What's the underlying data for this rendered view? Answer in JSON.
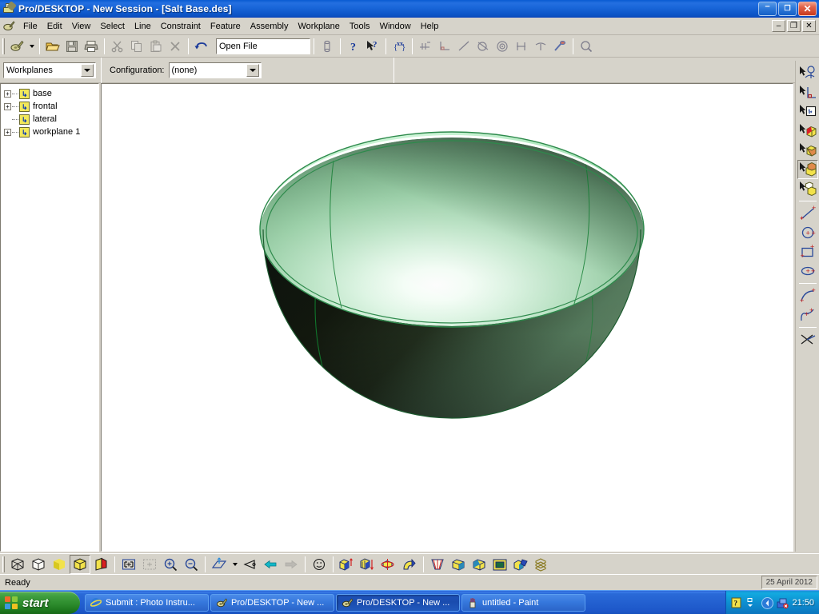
{
  "window": {
    "title": "Pro/DESKTOP - New Session - [Salt Base.des]",
    "app_icon": "printer-pen-icon",
    "minimize_label": "–",
    "restore_label": "❐",
    "close_label": "✕",
    "mdi_minimize_label": "–",
    "mdi_restore_label": "❐",
    "mdi_close_label": "✕"
  },
  "menubar": {
    "items": [
      {
        "label": "File"
      },
      {
        "label": "Edit"
      },
      {
        "label": "View"
      },
      {
        "label": "Select"
      },
      {
        "label": "Line"
      },
      {
        "label": "Constraint"
      },
      {
        "label": "Feature"
      },
      {
        "label": "Assembly"
      },
      {
        "label": "Workplane"
      },
      {
        "label": "Tools"
      },
      {
        "label": "Window"
      },
      {
        "label": "Help"
      }
    ]
  },
  "toolbar_main": {
    "buttons": [
      {
        "name": "new-design-button",
        "icon": "printer-pen-icon"
      },
      {
        "name": "new-design-dropdown",
        "icon": "chevron-down-icon"
      },
      {
        "name": "open-button",
        "icon": "open-folder-icon"
      },
      {
        "name": "save-button",
        "icon": "floppy-disk-icon"
      },
      {
        "name": "print-button",
        "icon": "printer-icon"
      },
      {
        "name": "cut-button",
        "icon": "scissors-icon"
      },
      {
        "name": "copy-button",
        "icon": "copy-icon"
      },
      {
        "name": "paste-button",
        "icon": "clipboard-icon"
      },
      {
        "name": "delete-button",
        "icon": "x-delete-icon"
      },
      {
        "name": "undo-button",
        "icon": "undo-arrow-icon"
      }
    ],
    "command_combo": {
      "value": "Open File",
      "placeholder": "Open File"
    },
    "buttons_right": [
      {
        "name": "properties-button",
        "icon": "cylinder-icon"
      },
      {
        "name": "help-button",
        "icon": "question-mark-icon"
      },
      {
        "name": "context-help-button",
        "icon": "arrow-question-icon"
      },
      {
        "name": "dimension-button",
        "icon": "xx-dimension-icon"
      },
      {
        "name": "add-dimension-button",
        "icon": "hash-dimension-icon"
      },
      {
        "name": "angle-constraint-button",
        "icon": "right-angle-icon"
      },
      {
        "name": "line-constraint-button",
        "icon": "diagonal-line-icon"
      },
      {
        "name": "tangent-constraint-button",
        "icon": "tangent-circle-icon"
      },
      {
        "name": "concentric-constraint-button",
        "icon": "concentric-circles-icon"
      },
      {
        "name": "equal-constraint-button",
        "icon": "equal-length-icon"
      },
      {
        "name": "parallel-constraint-button",
        "icon": "parallel-icon"
      },
      {
        "name": "fix-constraint-button",
        "icon": "anchor-pin-icon"
      },
      {
        "name": "zoom-button",
        "icon": "magnifier-icon"
      }
    ]
  },
  "configbar": {
    "workplane_combo": {
      "value": "Workplanes"
    },
    "configuration_label": "Configuration:",
    "configuration_combo": {
      "value": "(none)"
    }
  },
  "tree": {
    "items": [
      {
        "label": "base",
        "expandable": true,
        "expand_glyph": "+",
        "icon": "workplane-icon"
      },
      {
        "label": "frontal",
        "expandable": true,
        "expand_glyph": "+",
        "icon": "workplane-icon"
      },
      {
        "label": "lateral",
        "expandable": false,
        "expand_glyph": "",
        "icon": "workplane-icon"
      },
      {
        "label": "workplane 1",
        "expandable": true,
        "expand_glyph": "+",
        "icon": "workplane-icon"
      }
    ]
  },
  "viewport": {
    "model_name": "salt-base-hemisphere-bowl",
    "background": "#ffffff",
    "colors": {
      "rim_highlight": "#b8ecc6",
      "inner_light": "#f4fff6",
      "inner_mid": "#8fc9a2",
      "inner_edge": "#4f7d5c",
      "outer_mid": "#5d8567",
      "outer_dark": "#141a14",
      "edge_curve": "#0f7a2e",
      "outline": "#2e7d4a"
    }
  },
  "toolbar_right": {
    "buttons": [
      {
        "name": "select-feature-button",
        "icon": "select-sketch-icon",
        "pressed": false
      },
      {
        "name": "select-line-button",
        "icon": "select-corner-icon",
        "pressed": false
      },
      {
        "name": "select-workplane-button",
        "icon": "select-workplane-icon",
        "pressed": false
      },
      {
        "name": "select-face-button",
        "icon": "select-face-icon",
        "pressed": false
      },
      {
        "name": "select-part-button",
        "icon": "select-shaded-part-icon",
        "pressed": false
      },
      {
        "name": "select-solid-button",
        "icon": "select-solid-icon",
        "pressed": true
      },
      {
        "name": "select-assembly-button",
        "icon": "select-assembly-icon",
        "pressed": false
      },
      {
        "name": "draw-line-button",
        "icon": "line-tool-icon",
        "pressed": false
      },
      {
        "name": "draw-circle-button",
        "icon": "circle-tool-icon",
        "pressed": false
      },
      {
        "name": "draw-rectangle-button",
        "icon": "rectangle-tool-icon",
        "pressed": false
      },
      {
        "name": "draw-ellipse-button",
        "icon": "ellipse-tool-icon",
        "pressed": false
      },
      {
        "name": "draw-arc-button",
        "icon": "arc-tool-icon",
        "pressed": false
      },
      {
        "name": "draw-spline-button",
        "icon": "spline-tool-icon",
        "pressed": false
      },
      {
        "name": "trim-button",
        "icon": "scissors-trim-icon",
        "pressed": false
      }
    ]
  },
  "toolbar_bottom": {
    "buttons": [
      {
        "name": "wireframe-view-button",
        "icon": "wireframe-cube-icon",
        "pressed": false
      },
      {
        "name": "hidden-line-view-button",
        "icon": "hidden-line-cube-icon",
        "pressed": false
      },
      {
        "name": "shaded-view-button",
        "icon": "shaded-cube-icon",
        "pressed": false
      },
      {
        "name": "shaded-edges-view-button",
        "icon": "shaded-edges-cube-icon",
        "pressed": true
      },
      {
        "name": "rendered-view-button",
        "icon": "rendered-cube-icon",
        "pressed": false
      },
      {
        "name": "zoom-fit-button",
        "icon": "zoom-fit-icon",
        "pressed": false
      },
      {
        "name": "zoom-selection-button",
        "icon": "zoom-selection-icon",
        "pressed": false,
        "disabled": true
      },
      {
        "name": "zoom-in-button",
        "icon": "zoom-in-icon",
        "pressed": false
      },
      {
        "name": "zoom-out-button",
        "icon": "zoom-out-icon",
        "pressed": false
      },
      {
        "name": "workplane-view-button",
        "icon": "workplane-view-icon",
        "pressed": false
      },
      {
        "name": "workplane-view-dropdown",
        "icon": "chevron-down-icon",
        "pressed": false
      },
      {
        "name": "eye-view-button",
        "icon": "eye-view-icon",
        "pressed": false
      },
      {
        "name": "previous-view-button",
        "icon": "arrow-left-icon",
        "pressed": false
      },
      {
        "name": "next-view-button",
        "icon": "arrow-right-icon",
        "pressed": false,
        "disabled": true
      },
      {
        "name": "smiley-view-button",
        "icon": "smiley-icon",
        "pressed": false
      },
      {
        "name": "extrude-button",
        "icon": "extrude-icon",
        "pressed": false
      },
      {
        "name": "project-button",
        "icon": "project-icon",
        "pressed": false
      },
      {
        "name": "revolve-button",
        "icon": "revolve-icon",
        "pressed": false
      },
      {
        "name": "sweep-button",
        "icon": "sweep-icon",
        "pressed": false
      },
      {
        "name": "loft-button",
        "icon": "loft-icon",
        "pressed": false
      },
      {
        "name": "round-edge-button",
        "icon": "round-edge-icon",
        "pressed": false
      },
      {
        "name": "chamfer-button",
        "icon": "chamfer-icon",
        "pressed": false
      },
      {
        "name": "shell-button",
        "icon": "shell-icon",
        "pressed": false
      },
      {
        "name": "draft-button",
        "icon": "draft-icon",
        "pressed": false
      },
      {
        "name": "copy-feature-button",
        "icon": "copy-feature-icon",
        "pressed": false
      }
    ]
  },
  "statusbar": {
    "message": "Ready",
    "date": "25 April 2012"
  },
  "taskbar": {
    "start_label": "start",
    "items": [
      {
        "label": "Submit : Photo Instru...",
        "icon": "internet-explorer-icon",
        "active": false
      },
      {
        "label": "Pro/DESKTOP - New ...",
        "icon": "prodesktop-icon",
        "active": false
      },
      {
        "label": "Pro/DESKTOP - New ...",
        "icon": "prodesktop-icon",
        "active": true
      },
      {
        "label": "untitled - Paint",
        "icon": "paint-icon",
        "active": false
      }
    ],
    "tray": {
      "icons": [
        {
          "name": "help-notice-icon"
        },
        {
          "name": "show-hidden-icons-icon"
        },
        {
          "name": "volume-icon"
        },
        {
          "name": "network-error-icon"
        }
      ],
      "clock": "21:50"
    }
  }
}
